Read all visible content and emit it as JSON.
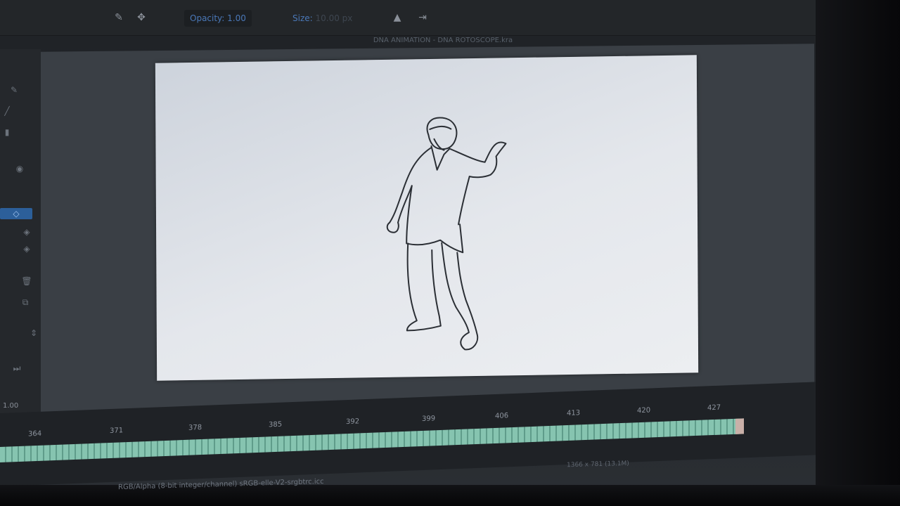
{
  "toolbar": {
    "opacity_label": "Opacity:",
    "opacity_value": "1.00",
    "size_label": "Size:",
    "size_value": "10.00 px"
  },
  "document": {
    "title": "DNA ANIMATION - DNA ROTOSCOPE.kra"
  },
  "timeline": {
    "ticks": [
      "364",
      "371",
      "378",
      "385",
      "392",
      "399",
      "406",
      "413",
      "420",
      "427"
    ]
  },
  "left_panel": {
    "value": "1.00"
  },
  "status_bar": {
    "color_space": "RGB/Alpha (8-bit integer/channel)  sRGB-elle-V2-srgbtrc.icc",
    "image_size": "1366 x 781 (13.1M)"
  },
  "colors": {
    "accent": "#4a78b8",
    "frame_cell": "#86c4b0",
    "canvas": "#e4e7ec"
  }
}
